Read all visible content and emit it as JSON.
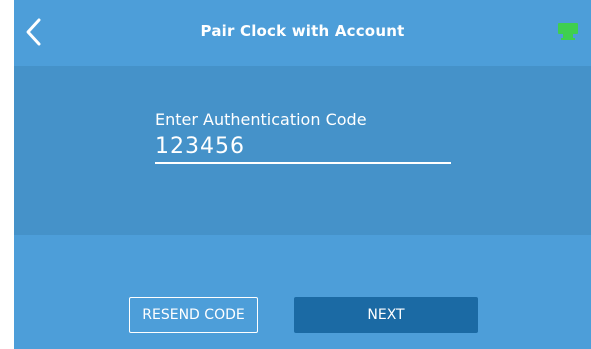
{
  "header": {
    "title": "Pair Clock with Account",
    "back_icon": "chevron-left-icon",
    "status_icon": "network-connected-icon",
    "status_color": "#3fcf4f"
  },
  "form": {
    "label": "Enter Authentication Code",
    "code_value": "123456"
  },
  "actions": {
    "resend_label": "RESEND CODE",
    "next_label": "NEXT"
  },
  "colors": {
    "background": "#4d9ed9",
    "panel": "#4592c9",
    "primary_button": "#1b6aa4"
  }
}
